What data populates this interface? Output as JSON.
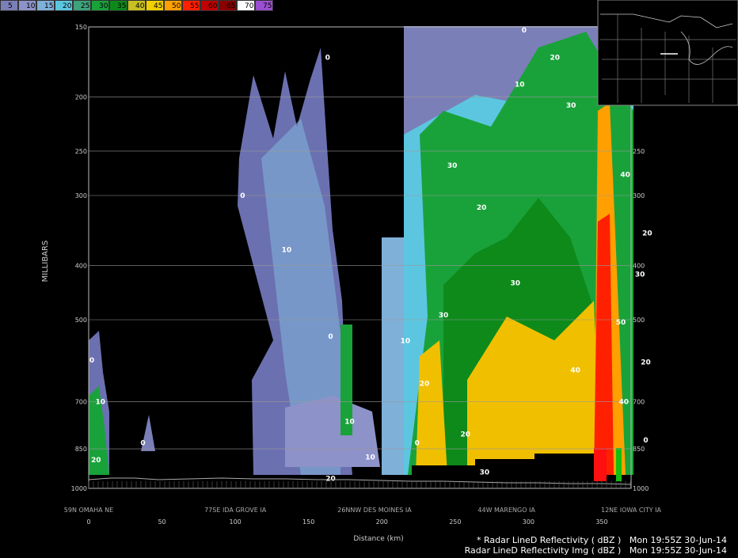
{
  "colorbar": {
    "ticks": [
      "5",
      "10",
      "15",
      "20",
      "25",
      "30",
      "35",
      "40",
      "45",
      "50",
      "55",
      "60",
      "65",
      "70",
      "75"
    ],
    "colors": [
      "#7b7fb8",
      "#8d92c8",
      "#7fb0d8",
      "#5cc6e0",
      "#3fa27a",
      "#19a23a",
      "#0d8a1a",
      "#c8c020",
      "#f0d000",
      "#ffa000",
      "#ff2000",
      "#c00000",
      "#8a0000",
      "#ffffff",
      "#9a4fd0"
    ]
  },
  "chart_data": {
    "type": "heatmap",
    "title": "",
    "xlabel": "Distance (km)",
    "ylabel": "MILLIBARS",
    "x_ticks": [
      0,
      50,
      100,
      150,
      200,
      250,
      300,
      350
    ],
    "xlim": [
      0,
      370
    ],
    "y_ticks": [
      150,
      200,
      250,
      300,
      400,
      500,
      700,
      850,
      1000
    ],
    "ylim": [
      150,
      1000
    ],
    "y_scale": "log-pressure",
    "locations": [
      {
        "label": "59N OMAHA NE",
        "x": 0
      },
      {
        "label": "77SE IDA GROVE IA",
        "x": 100
      },
      {
        "label": "26NNW DES MOINES IA",
        "x": 195
      },
      {
        "label": "44W MARENGO IA",
        "x": 285
      },
      {
        "label": "12NE IOWA CITY IA",
        "x": 370
      }
    ],
    "contour_labels": [
      {
        "text": "0",
        "x": 163,
        "p": 170
      },
      {
        "text": "0",
        "x": 105,
        "p": 300
      },
      {
        "text": "10",
        "x": 135,
        "p": 375
      },
      {
        "text": "0",
        "x": 165,
        "p": 535
      },
      {
        "text": "0",
        "x": 0,
        "p": 590
      },
      {
        "text": "10",
        "x": 8,
        "p": 700
      },
      {
        "text": "20",
        "x": 5,
        "p": 890
      },
      {
        "text": "0",
        "x": 37,
        "p": 830
      },
      {
        "text": "10",
        "x": 178,
        "p": 760
      },
      {
        "text": "10",
        "x": 192,
        "p": 880
      },
      {
        "text": "20",
        "x": 165,
        "p": 960
      },
      {
        "text": "0",
        "x": 224,
        "p": 830
      },
      {
        "text": "20",
        "x": 229,
        "p": 650
      },
      {
        "text": "30",
        "x": 242,
        "p": 490
      },
      {
        "text": "10",
        "x": 216,
        "p": 545
      },
      {
        "text": "30",
        "x": 248,
        "p": 265
      },
      {
        "text": "20",
        "x": 268,
        "p": 315
      },
      {
        "text": "30",
        "x": 291,
        "p": 430
      },
      {
        "text": "10",
        "x": 294,
        "p": 190
      },
      {
        "text": "20",
        "x": 318,
        "p": 170
      },
      {
        "text": "30",
        "x": 329,
        "p": 207
      },
      {
        "text": "20",
        "x": 354,
        "p": 160
      },
      {
        "text": "40",
        "x": 332,
        "p": 615
      },
      {
        "text": "40",
        "x": 366,
        "p": 275
      },
      {
        "text": "50",
        "x": 363,
        "p": 505
      },
      {
        "text": "40",
        "x": 365,
        "p": 700
      },
      {
        "text": "30",
        "x": 376,
        "p": 415
      },
      {
        "text": "20",
        "x": 381,
        "p": 350
      },
      {
        "text": "20",
        "x": 380,
        "p": 595
      },
      {
        "text": "0",
        "x": 380,
        "p": 820
      },
      {
        "text": "20",
        "x": 257,
        "p": 800
      },
      {
        "text": "30",
        "x": 270,
        "p": 935
      },
      {
        "text": "0",
        "x": 297,
        "p": 152
      }
    ]
  },
  "footer": {
    "line1": "* Radar LineD Reflectivity ( dBZ )   Mon 19:55Z 30-Jun-14",
    "line2": "Radar LineD Reflectivity Img ( dBZ )   Mon 19:55Z 30-Jun-14"
  }
}
